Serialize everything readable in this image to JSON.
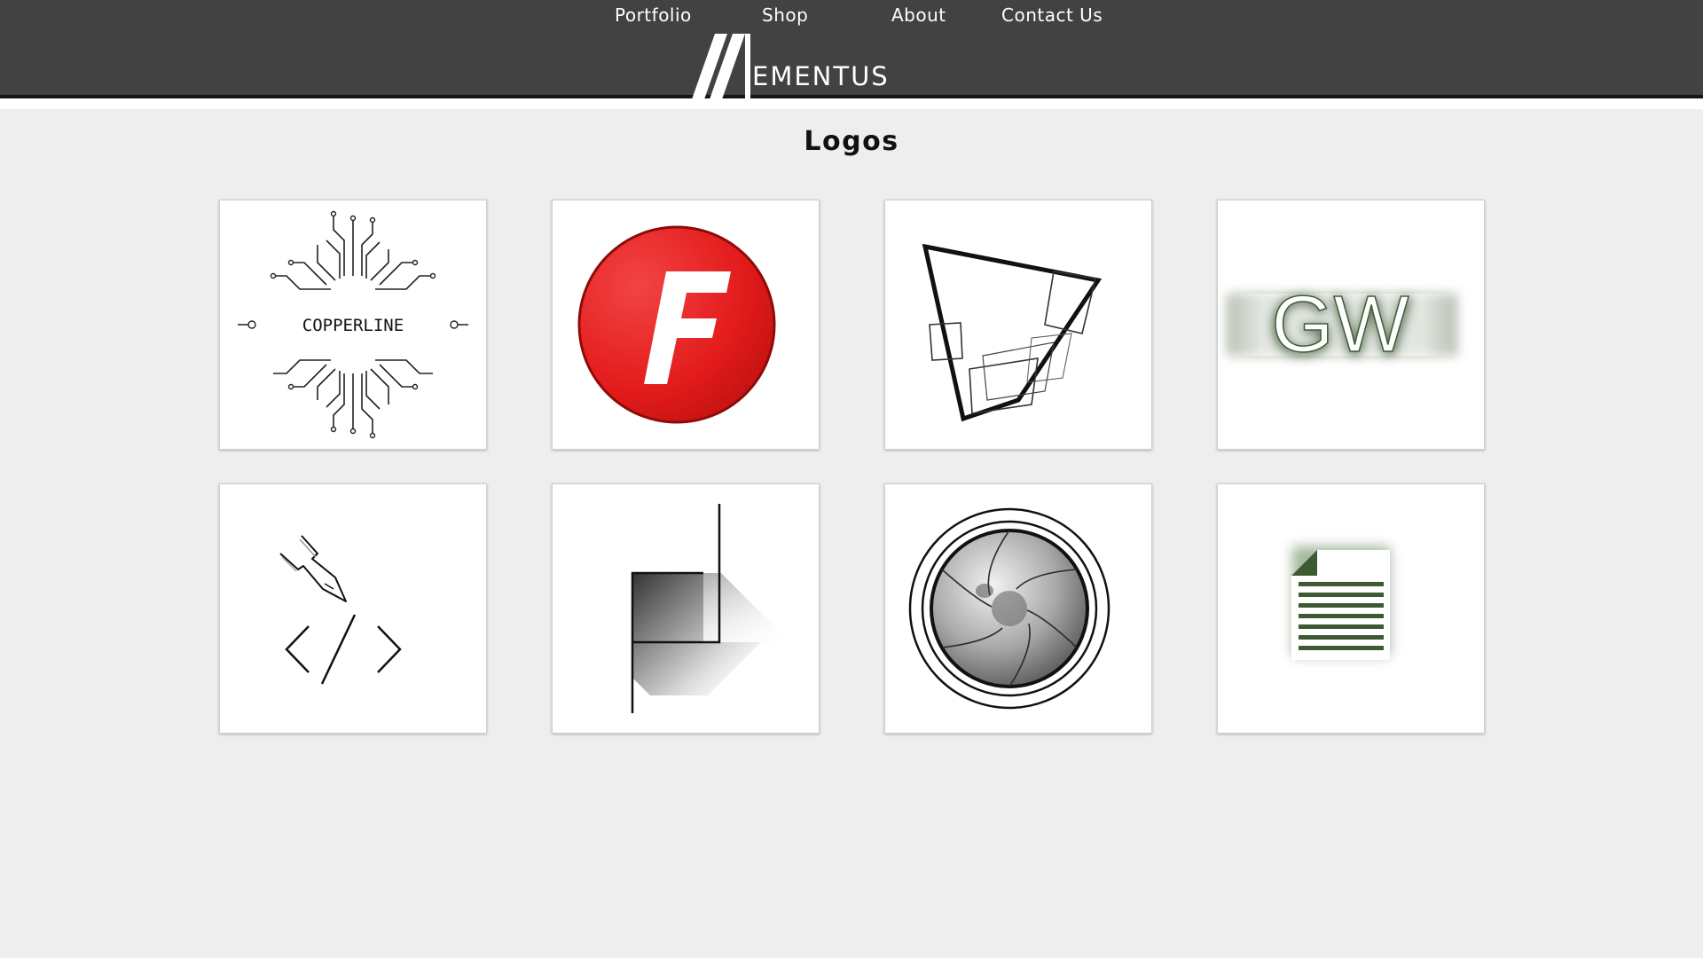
{
  "nav": {
    "items": [
      {
        "label": "Portfolio"
      },
      {
        "label": "Shop"
      },
      {
        "label": "About"
      },
      {
        "label": "Contact Us"
      }
    ]
  },
  "brand": {
    "wordmark": "EMENTUS"
  },
  "page": {
    "title": "Logos"
  },
  "gallery": {
    "tiles": [
      {
        "icon": "copperline-circuit-logo",
        "text": "COPPERLINE"
      },
      {
        "icon": "red-f-circle-logo",
        "text": "F"
      },
      {
        "icon": "geometric-frames-logo"
      },
      {
        "icon": "gw-glow-logo",
        "text": "GW"
      },
      {
        "icon": "pen-code-logo"
      },
      {
        "icon": "gradient-flag-logo"
      },
      {
        "icon": "camera-aperture-logo"
      },
      {
        "icon": "green-document-logo"
      }
    ]
  },
  "colors": {
    "header": "#424242",
    "page_background": "#eeeeee",
    "accent_red": "#e31b1b",
    "accent_green": "#3d5a32"
  }
}
